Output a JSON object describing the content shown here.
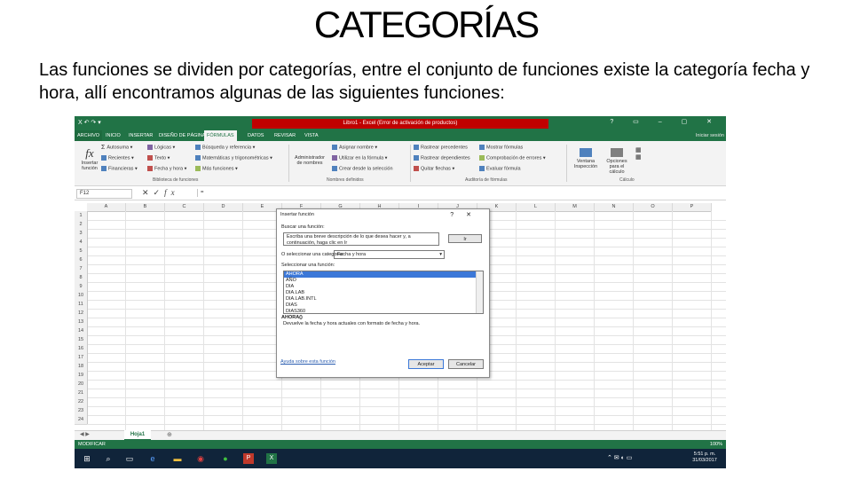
{
  "slide": {
    "title": "CATEGORÍAS",
    "text": "Las funciones se dividen por categorías, entre el conjunto de funciones existe la categoría fecha y hora, allí encontramos  algunas de las siguientes funciones:"
  },
  "excel": {
    "window_title": "Libro1 - Excel (Error de activación de productos)",
    "tabs": [
      "ARCHIVO",
      "INICIO",
      "INSERTAR",
      "DISEÑO DE PÁGINA",
      "FÓRMULAS",
      "DATOS",
      "REVISAR",
      "VISTA"
    ],
    "active_tab": "FÓRMULAS",
    "user": "Iniciar sesión",
    "ribbon": {
      "insert_function": "Insertar función",
      "autosum": "Autosuma",
      "recent": "Recientes",
      "financial": "Financieras",
      "logical": "Lógicas",
      "text": "Texto",
      "datetime": "Fecha y hora",
      "lookup": "Búsqueda y referencia",
      "math": "Matemáticas y trigonométricas",
      "more": "Más funciones",
      "group_library": "Biblioteca de funciones",
      "name_manager": "Administrador de nombres",
      "define_name": "Asignar nombre",
      "use_in_formula": "Utilizar en la fórmula",
      "create_from_selection": "Crear desde la selección",
      "group_names": "Nombres definidos",
      "trace_precedents": "Rastrear precedentes",
      "trace_dependents": "Rastrear dependientes",
      "remove_arrows": "Quitar flechas",
      "show_formulas": "Mostrar fórmulas",
      "error_checking": "Comprobación de errores",
      "evaluate_formula": "Evaluar fórmula",
      "group_auditing": "Auditoría de fórmulas",
      "watch_window": "Ventana Inspección",
      "calc_options": "Opciones para el cálculo",
      "group_calc": "Cálculo"
    },
    "name_box": "F12",
    "formula_value": "=",
    "columns": [
      "A",
      "B",
      "C",
      "D",
      "E",
      "F",
      "G",
      "H",
      "I",
      "J",
      "K",
      "L",
      "M",
      "N",
      "O",
      "P"
    ],
    "rows": [
      "1",
      "2",
      "3",
      "4",
      "5",
      "6",
      "7",
      "8",
      "9",
      "10",
      "11",
      "12",
      "13",
      "14",
      "15",
      "16",
      "17",
      "18",
      "19",
      "20",
      "21",
      "22",
      "23",
      "24"
    ],
    "sheet_tab": "Hoja1",
    "status_mode": "MODIFICAR",
    "zoom": "100%",
    "clock_time": "5:51 p. m.",
    "clock_date": "31/03/2017"
  },
  "dialog": {
    "title": "Insertar función",
    "search_label": "Buscar una función:",
    "search_value": "Escriba una breve descripción de lo que desea hacer y, a continuación, haga clic en Ir",
    "go_button": "Ir",
    "category_label": "O seleccionar una categoría:",
    "category_value": "Fecha y hora",
    "function_label": "Seleccionar una función:",
    "functions": [
      "AHORA",
      "AÑO",
      "DIA",
      "DIA.LAB",
      "DIA.LAB.INTL",
      "DIAS",
      "DIAS360"
    ],
    "selected_function": "AHORA",
    "signature": "AHORA()",
    "description": "Devuelve la fecha y hora actuales con formato de fecha y hora.",
    "help_link": "Ayuda sobre esta función",
    "ok_button": "Aceptar",
    "cancel_button": "Cancelar"
  },
  "colors": {
    "excel_green": "#217346",
    "title_red": "#c00000",
    "taskbar": "#10243a",
    "selection": "#3c78d8"
  }
}
